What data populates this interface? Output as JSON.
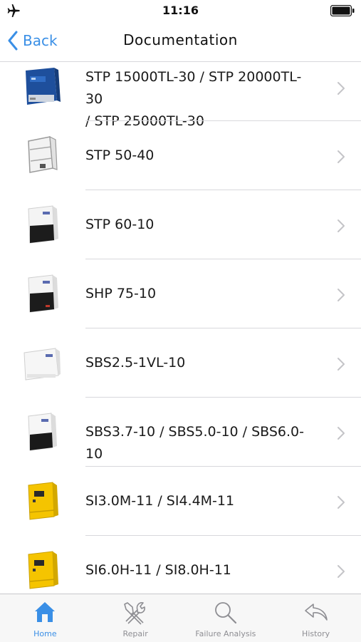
{
  "status_bar": {
    "time": "11:16"
  },
  "nav": {
    "back_label": "Back",
    "title": "Documentation"
  },
  "documents": [
    {
      "label": "STP 15000TL-30 / STP 20000TL-30\n/ STP 25000TL-30",
      "icon": "blue-inverter-thumb"
    },
    {
      "label": "STP 50-40",
      "icon": "frame-inverter-thumb"
    },
    {
      "label": "STP 60-10",
      "icon": "white-black-inverter-thumb"
    },
    {
      "label": "SHP 75-10",
      "icon": "white-black-inverter-thumb"
    },
    {
      "label": "SBS2.5-1VL-10",
      "icon": "white-inverter-thumb"
    },
    {
      "label": "SBS3.7-10 / SBS5.0-10 / SBS6.0-10",
      "icon": "white-black-inverter-thumb"
    },
    {
      "label": "SI3.0M-11 / SI4.4M-11",
      "icon": "yellow-inverter-thumb"
    },
    {
      "label": "SI6.0H-11 / SI8.0H-11",
      "icon": "yellow-inverter-thumb"
    }
  ],
  "tabs": [
    {
      "label": "Home",
      "icon": "home-icon",
      "active": true
    },
    {
      "label": "Repair",
      "icon": "tools-icon",
      "active": false
    },
    {
      "label": "Failure Analysis",
      "icon": "magnifier-icon",
      "active": false
    },
    {
      "label": "History",
      "icon": "history-back-icon",
      "active": false
    }
  ],
  "colors": {
    "accent": "#3a8fe6",
    "inactive_tab": "#8e8e93",
    "separator": "#d8d8dc",
    "sma_yellow": "#f5c400"
  }
}
